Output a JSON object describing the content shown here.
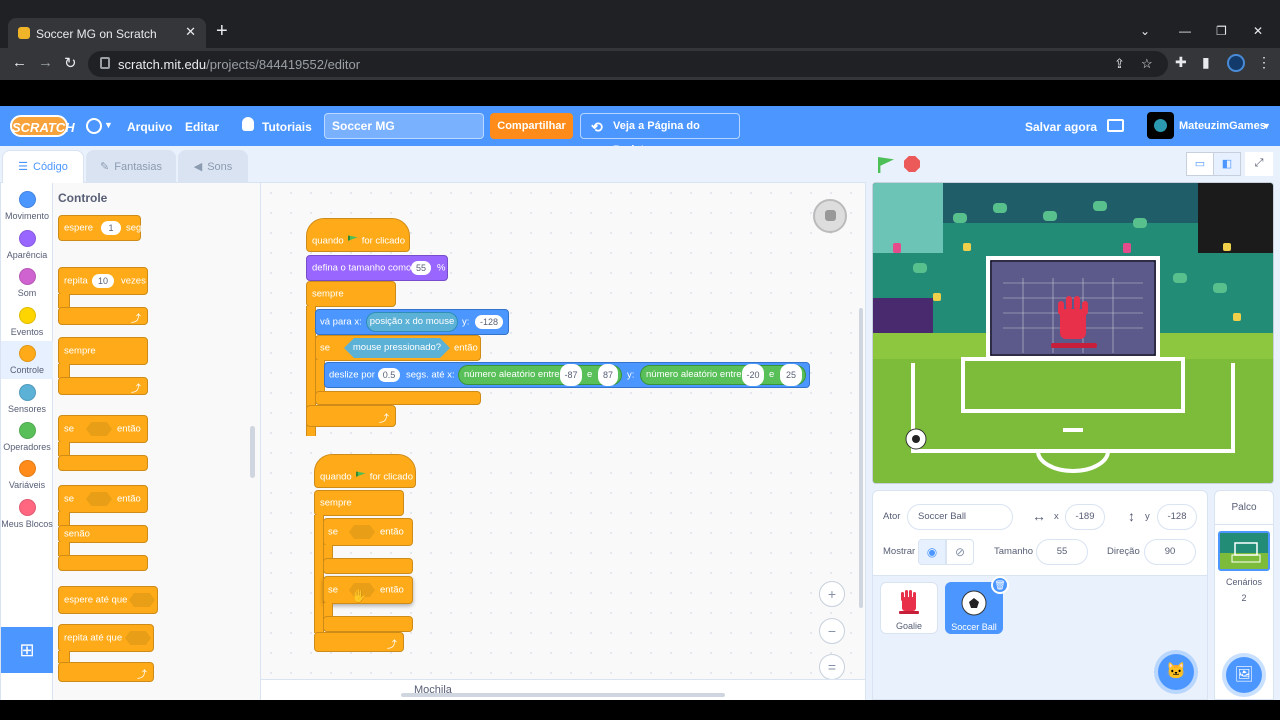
{
  "browser": {
    "tab_title": "Soccer MG on Scratch",
    "url_host": "scratch.mit.edu",
    "url_path": "/projects/844419552/editor"
  },
  "menu": {
    "logo": "SCRATCH",
    "file": "Arquivo",
    "edit": "Editar",
    "tutorials": "Tutoriais",
    "project_title": "Soccer MG",
    "share": "Compartilhar",
    "see_project": "Veja a Página do Projeto",
    "save_now": "Salvar agora",
    "username": "MateuzimGames"
  },
  "editor_tabs": {
    "code": "Código",
    "costumes": "Fantasias",
    "sounds": "Sons"
  },
  "categories": [
    {
      "label": "Movimento",
      "color": "#4c97ff"
    },
    {
      "label": "Aparência",
      "color": "#9966ff"
    },
    {
      "label": "Som",
      "color": "#cf63cf"
    },
    {
      "label": "Eventos",
      "color": "#ffd500"
    },
    {
      "label": "Controle",
      "color": "#ffab19"
    },
    {
      "label": "Sensores",
      "color": "#5cb1d6"
    },
    {
      "label": "Operadores",
      "color": "#59c059"
    },
    {
      "label": "Variáveis",
      "color": "#ff8c1a"
    },
    {
      "label": "Meus Blocos",
      "color": "#ff6680"
    }
  ],
  "palette": {
    "title": "Controle",
    "wait": "espere",
    "wait_value": "1",
    "wait_unit": "seg",
    "repeat": "repita",
    "repeat_value": "10",
    "repeat_unit": "vezes",
    "forever": "sempre",
    "if": "se",
    "then": "então",
    "else": "senão",
    "wait_until": "espere até que",
    "repeat_until": "repita até que"
  },
  "script1": {
    "when": "quando",
    "clicked": "for clicado",
    "set_size": "defina o tamanho como",
    "size_value": "55",
    "percent": "%",
    "forever": "sempre",
    "goto_x": "vá para x:",
    "mouse_x": "posição x do mouse",
    "y_label": "y:",
    "y_value": "-128",
    "if": "se",
    "mouse_down": "mouse pressionado?",
    "then": "então",
    "glide": "deslize por",
    "glide_secs": "0.5",
    "secs_to_x": "segs. até x:",
    "random1": "número aleatório entre",
    "r1_from": "-87",
    "and": "e",
    "r1_to": "87",
    "y2": "y:",
    "random2": "número aleatório entre",
    "r2_from": "-20",
    "r2_to": "25"
  },
  "script2": {
    "when": "quando",
    "clicked": "for clicado",
    "forever": "sempre",
    "if1": "se",
    "then1": "então",
    "if2": "se",
    "then2": "então"
  },
  "workspace": {
    "backpack": "Mochila",
    "zoom_in": "+",
    "zoom_out": "−",
    "zoom_reset": "="
  },
  "sprite_info": {
    "sprite_label": "Ator",
    "sprite_name": "Soccer Ball",
    "x_label": "x",
    "x_value": "-189",
    "y_label": "y",
    "y_value": "-128",
    "show_label": "Mostrar",
    "size_label": "Tamanho",
    "size_value": "55",
    "direction_label": "Direção",
    "direction_value": "90"
  },
  "sprites": [
    {
      "name": "Goalie"
    },
    {
      "name": "Soccer Ball"
    }
  ],
  "stage_panel": {
    "title": "Palco",
    "backdrops_label": "Cenários",
    "backdrops_count": "2"
  }
}
